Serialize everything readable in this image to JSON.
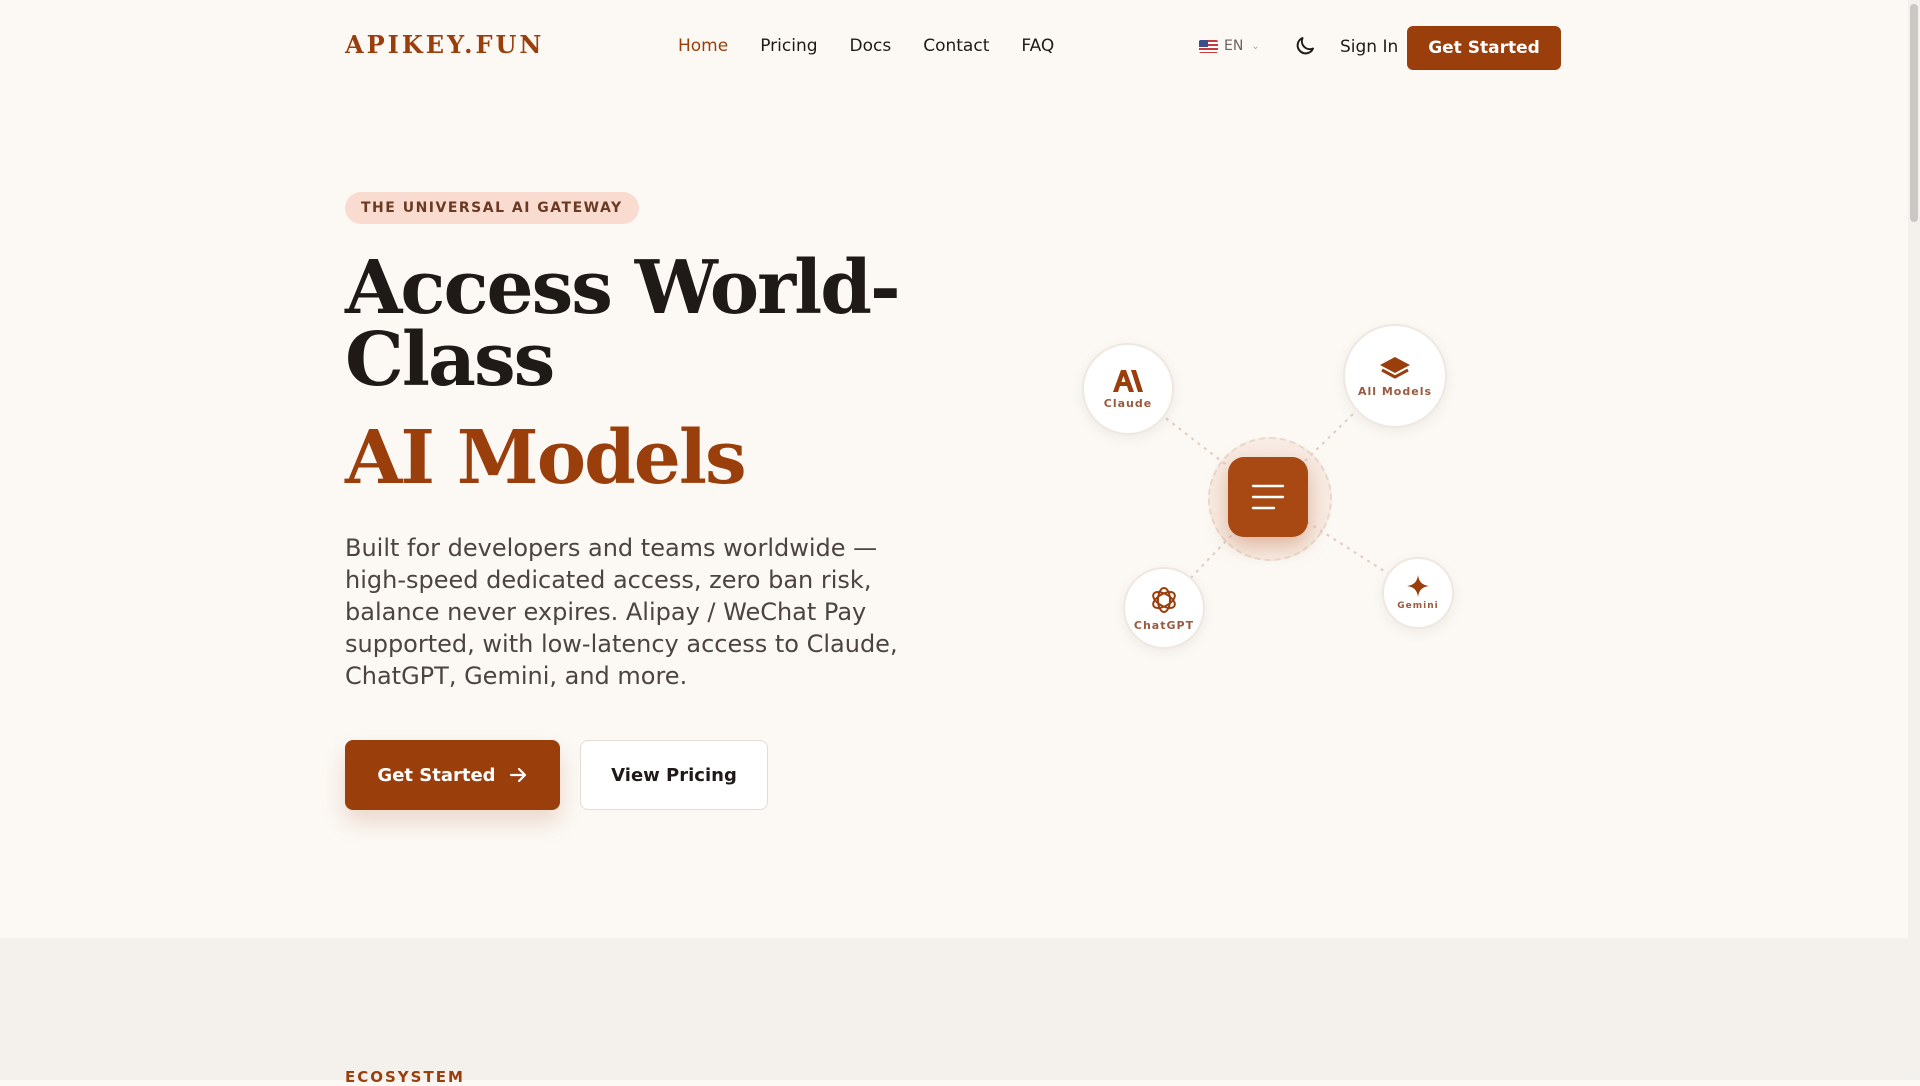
{
  "brand": {
    "logo": "APIKEY.FUN",
    "accent_color": "#9a3e0c"
  },
  "nav": {
    "items": [
      {
        "label": "Home",
        "active": true
      },
      {
        "label": "Pricing",
        "active": false
      },
      {
        "label": "Docs",
        "active": false
      },
      {
        "label": "Contact",
        "active": false
      },
      {
        "label": "FAQ",
        "active": false
      }
    ]
  },
  "language": {
    "flag": "us-flag-icon",
    "code": "EN"
  },
  "header": {
    "theme_icon": "moon-icon",
    "signin_label": "Sign In",
    "cta_label": "Get Started"
  },
  "hero": {
    "badge": "THE UNIVERSAL AI GATEWAY",
    "title_line1": "Access World-Class",
    "title_accent": "AI Models",
    "lead": "Built for developers and teams worldwide — high-speed dedicated access, zero ban risk, balance never expires. Alipay / WeChat Pay supported, with low-latency access to Claude, ChatGPT, Gemini, and more.",
    "primary_cta": "Get Started",
    "secondary_cta": "View Pricing"
  },
  "diagram": {
    "hub_icon": "menu-icon",
    "nodes": [
      {
        "label": "Claude",
        "icon": "claude-icon"
      },
      {
        "label": "All Models",
        "icon": "layers-icon"
      },
      {
        "label": "ChatGPT",
        "icon": "openai-icon"
      },
      {
        "label": "Gemini",
        "icon": "sparkle-icon"
      }
    ]
  },
  "section2": {
    "eyebrow": "ECOSYSTEM"
  }
}
